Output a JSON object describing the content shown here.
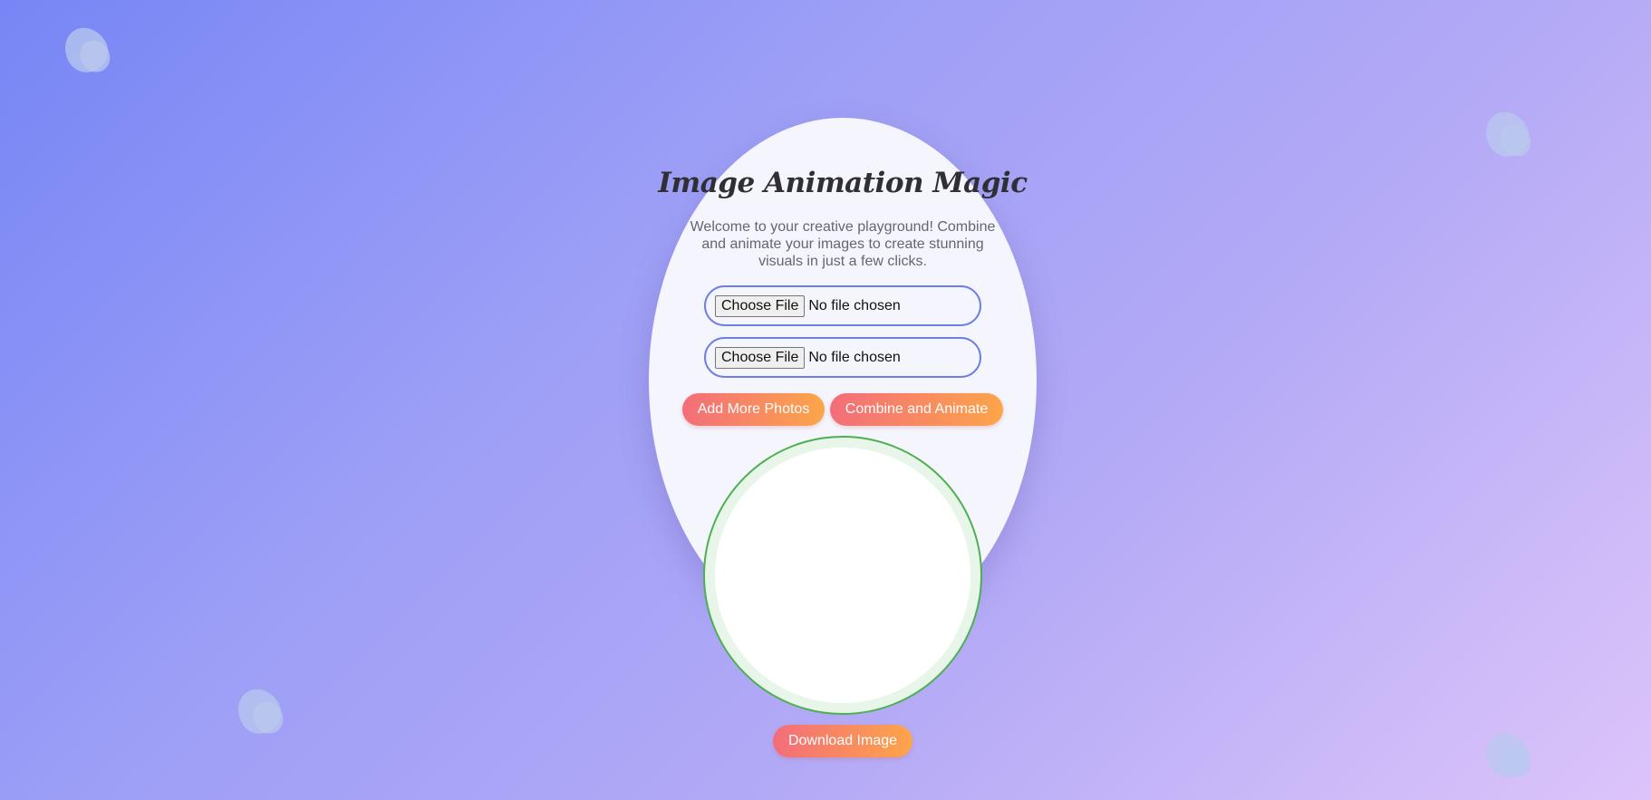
{
  "page": {
    "title": "Image Animation Magic",
    "subtitle": "Welcome to your creative playground! Combine and animate your images to create stunning visuals in just a few clicks."
  },
  "uploads": [
    {
      "button_label": "Choose File",
      "status": "No file chosen"
    },
    {
      "button_label": "Choose File",
      "status": "No file chosen"
    }
  ],
  "actions": {
    "add_more_label": "Add More Photos",
    "combine_label": "Combine and Animate",
    "download_label": "Download Image"
  },
  "icons": [
    "petal-decoration-icon"
  ],
  "colors": {
    "accent_start": "#f36d7a",
    "accent_end": "#fca54a",
    "input_border": "#6d7fe6",
    "preview_border": "#4caf50",
    "card_bg": "#f5f5fd"
  }
}
